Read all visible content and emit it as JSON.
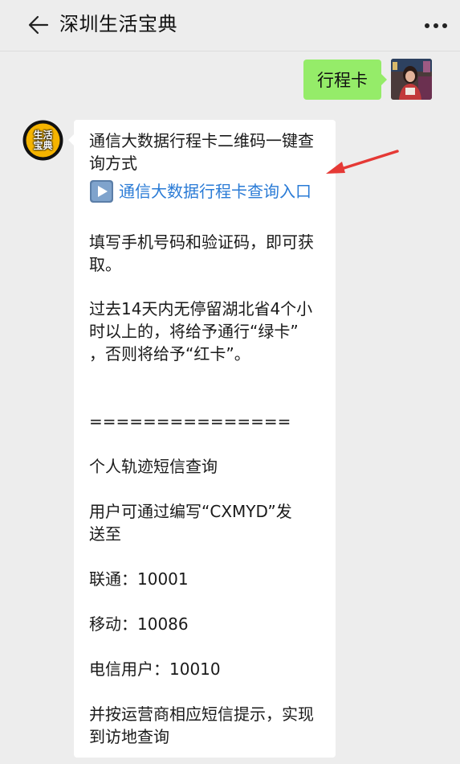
{
  "header": {
    "title": "深圳生活宝典"
  },
  "chat": {
    "outgoing_message": "行程卡",
    "bot_avatar_text": [
      "生活",
      "宝典"
    ],
    "incoming": {
      "lines": [
        "通信大数据行程卡二维码一键查",
        "询方式",
        "填写手机号码和验证码，即可获",
        "取。",
        "过去14天内无停留湖北省4个小",
        "时以上的，将给予通行“绿卡”",
        "，否则将给予“红卡”。",
        "===============",
        "个人轨迹短信查询",
        "用户可通过编写“CXMYD”发",
        "送至",
        "联通：10001",
        "移动：10086",
        "电信用户：10010",
        "并按运营商相应短信提示，实现",
        "到访地查询"
      ],
      "link_text": "通信大数据行程卡查询入口"
    }
  },
  "colors": {
    "background": "#ededed",
    "outgoing_bubble": "#95ec69",
    "incoming_bubble": "#ffffff",
    "link": "#2a7bd6",
    "annotation_arrow": "#e53935",
    "bot_avatar_ring": "#f5b400"
  },
  "icons": {
    "back": "arrow-left-icon",
    "more": "more-dots-icon",
    "play": "play-icon",
    "annotation": "red-arrow-icon"
  }
}
